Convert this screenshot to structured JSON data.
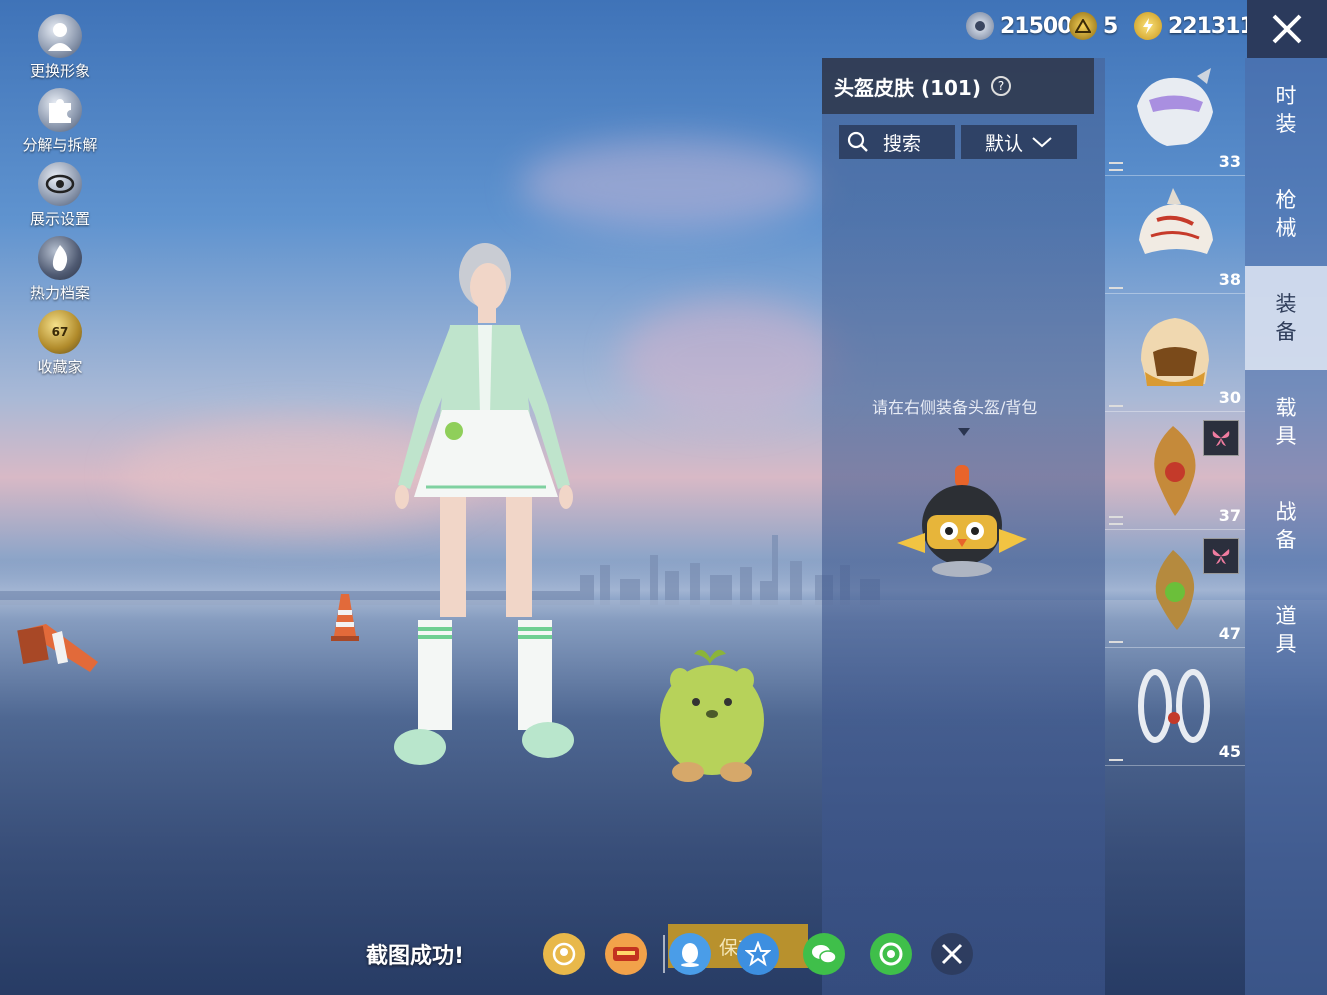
{
  "left_menu": [
    {
      "name": "change-appearance",
      "label": "更换形象",
      "icon": "person-icon"
    },
    {
      "name": "decompose",
      "label": "分解与拆解",
      "icon": "puzzle-icon"
    },
    {
      "name": "display-settings",
      "label": "展示设置",
      "icon": "eye-icon"
    },
    {
      "name": "heat-archive",
      "label": "热力档案",
      "icon": "flame-icon"
    },
    {
      "name": "collector",
      "label": "收藏家",
      "icon": "collector-badge-icon",
      "badge": "67"
    }
  ],
  "currencies": [
    {
      "name": "silver",
      "value": "21500",
      "color": "#b7c4d8"
    },
    {
      "name": "gold-token",
      "value": "5",
      "color": "#e6b321"
    },
    {
      "name": "energy",
      "value": "221311",
      "color": "#f0c636"
    }
  ],
  "panel": {
    "title": "头盔皮肤 (101)",
    "help": "?",
    "search": "搜索",
    "sort": "默认",
    "hint": "请在右侧装备头盔/背包"
  },
  "items": [
    {
      "count": "33",
      "menu": "double"
    },
    {
      "count": "38",
      "menu": "single"
    },
    {
      "count": "30",
      "menu": "single"
    },
    {
      "count": "37",
      "menu": "double",
      "badge": true
    },
    {
      "count": "47",
      "menu": "single",
      "badge": true
    },
    {
      "count": "45",
      "menu": "single"
    }
  ],
  "categories": [
    {
      "l1": "时",
      "l2": "装",
      "active": false
    },
    {
      "l1": "枪",
      "l2": "械",
      "active": false
    },
    {
      "l1": "装",
      "l2": "备",
      "active": true
    },
    {
      "l1": "载",
      "l2": "具",
      "active": false
    },
    {
      "l1": "战",
      "l2": "备",
      "active": false
    },
    {
      "l1": "道",
      "l2": "具",
      "active": false
    }
  ],
  "bottom": {
    "toast": "截图成功!",
    "save_label": "保存",
    "shares": [
      "game-center-icon",
      "peace-elite-icon",
      "qq-icon",
      "qzone-icon",
      "wechat-icon",
      "moments-icon",
      "close-icon"
    ]
  },
  "colors": {
    "accent": "#b8912d",
    "panel": "#303a50",
    "active_tab": "#e1e8f5"
  }
}
